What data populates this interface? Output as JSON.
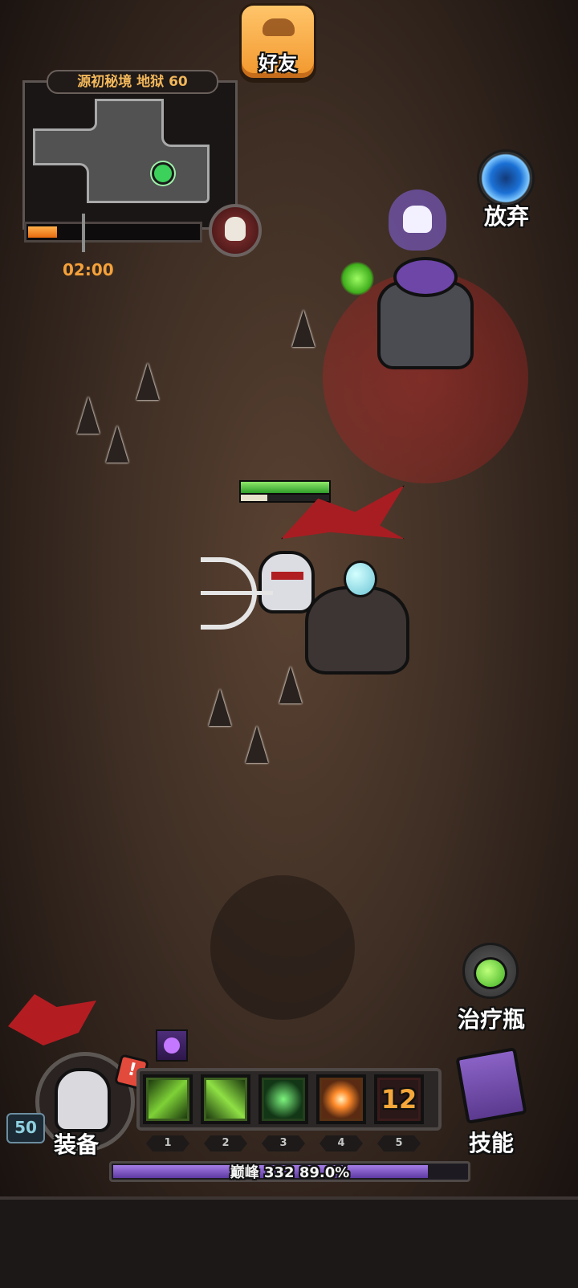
{
  "header": {
    "friends_label": "好友"
  },
  "minimap": {
    "title": "源初秘境 地狱 60",
    "progress": 0.17,
    "timer": "02:00"
  },
  "actions": {
    "abandon_label": "放弃",
    "potion_label": "治疗瓶",
    "equipment_label": "装备",
    "skills_label": "技能"
  },
  "player": {
    "level": "50",
    "hp": 1.0,
    "mp": 0.3,
    "alert": "!"
  },
  "skill_bar": {
    "slots": [
      {
        "key": "1",
        "icon": "green-arrow-skill-icon"
      },
      {
        "key": "2",
        "icon": "green-volley-skill-icon"
      },
      {
        "key": "3",
        "icon": "green-rain-skill-icon"
      },
      {
        "key": "4",
        "icon": "galaxy-skill-icon"
      },
      {
        "key": "5",
        "icon": "cooldown-skill-icon",
        "cooldown": "12"
      }
    ]
  },
  "experience": {
    "text": "巅峰 332 89.0%",
    "fraction": 0.89
  },
  "colors": {
    "accent_orange": "#f5a13a",
    "danger_red": "#c82828",
    "exp_purple": "#a57ee6"
  }
}
